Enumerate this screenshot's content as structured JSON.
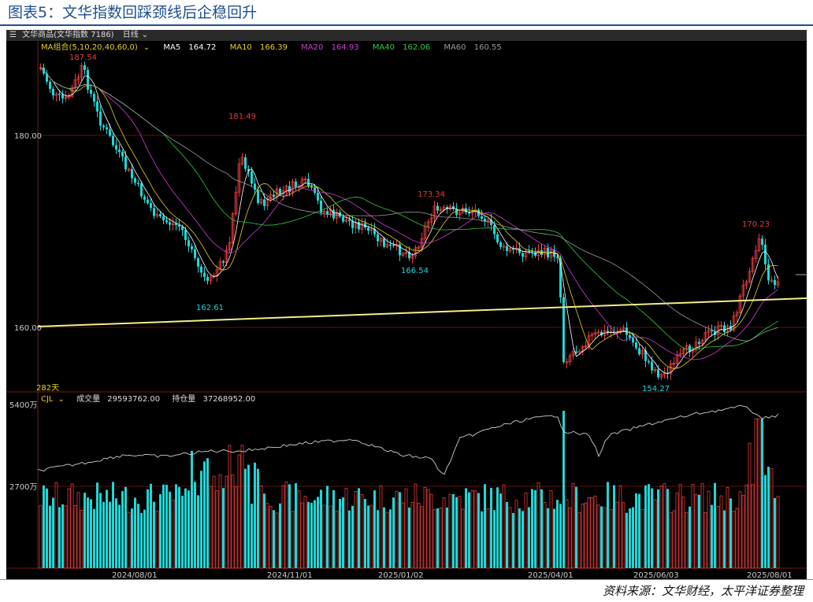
{
  "figure_title": "图表5：文华指数回踩颈线后企稳回升",
  "source_note": "资料来源：文华财经，太平洋证券整理",
  "toolbar": {
    "instrument": "文华商品(文华指数 7186)",
    "period": "日线"
  },
  "ma_panel": {
    "label": "MA组合(5,10,20,40,60,0)",
    "items": [
      {
        "name": "MA5",
        "value": "164.72",
        "color": "#ffffff"
      },
      {
        "name": "MA10",
        "value": "166.39",
        "color": "#e6d21a"
      },
      {
        "name": "MA20",
        "value": "164.93",
        "color": "#d23cd2"
      },
      {
        "name": "MA40",
        "value": "162.06",
        "color": "#2ecc40"
      },
      {
        "name": "MA60",
        "value": "160.55",
        "color": "#9a9a9a"
      }
    ]
  },
  "price_axis": {
    "tick_180": "180.00",
    "tick_160": "160.00"
  },
  "days_label": "282天",
  "annotations": {
    "high1": "187.54",
    "high2": "181.49",
    "low1": "162.61",
    "high3": "173.34",
    "low2": "166.54",
    "low3": "154.27",
    "high4": "170.23"
  },
  "volume_panel": {
    "name": "CJL",
    "vol_label": "成交量",
    "vol_value": "29593762.00",
    "oi_label": "持仓量",
    "oi_value": "37268952.00",
    "tick_5400": "5400万",
    "tick_2700": "2700万"
  },
  "date_axis": [
    "2024/08/01",
    "2024/11/01",
    "2025/01/02",
    "2025/04/01",
    "2025/06/03",
    "2025/08/01"
  ],
  "colors": {
    "up": "#e23b3b",
    "down": "#1fd6d6",
    "neckline": "#f2ee8a",
    "background": "#000000"
  }
}
